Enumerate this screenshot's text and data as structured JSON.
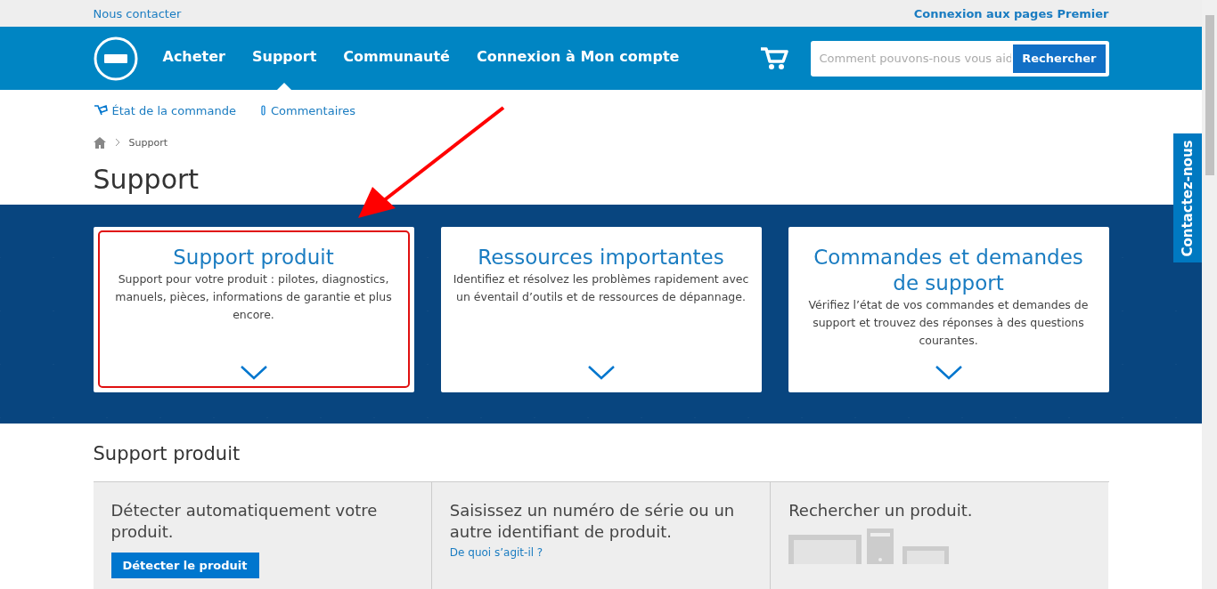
{
  "top_bar": {
    "left_link": "Nous contacter",
    "right_link": "Connexion aux pages Premier"
  },
  "nav": {
    "items": [
      {
        "label": "Acheter",
        "selected": false
      },
      {
        "label": "Support",
        "selected": true
      },
      {
        "label": "Communauté",
        "selected": false
      },
      {
        "label": "Connexion à Mon compte",
        "selected": false
      }
    ],
    "search": {
      "placeholder": "Comment pouvons-nous vous aid",
      "button": "Rechercher"
    }
  },
  "subnav": [
    {
      "label": "État de la commande",
      "kind": "order"
    },
    {
      "label": "Commentaires",
      "kind": "feedback"
    }
  ],
  "breadcrumb": [
    "Support"
  ],
  "page_title": "Support",
  "cards": [
    {
      "title": "Support produit",
      "text": "Support pour votre produit : pilotes, diagnostics, manuels, pièces, informations de garantie et plus encore.",
      "highlighted": true
    },
    {
      "title": "Ressources importantes",
      "text": "Identifiez et résolvez les problèmes rapidement avec un éventail d’outils et de ressources de dépannage.",
      "highlighted": false
    },
    {
      "title": "Commandes et demandes de support",
      "text": "Vérifiez l’état de vos commandes et demandes de support et trouvez des réponses à des questions courantes.",
      "highlighted": false
    }
  ],
  "section_title": "Support produit",
  "panels": [
    {
      "kind": "detect",
      "title": "Détecter automatiquement votre produit.",
      "button": "Détecter le produit"
    },
    {
      "kind": "serial",
      "title": "Saisissez un numéro de série ou un autre identifiant de produit.",
      "link": "De quoi s’agit-il ?"
    },
    {
      "kind": "browse",
      "title": "Rechercher un produit."
    }
  ],
  "contact_tab": "Contactez-nous"
}
